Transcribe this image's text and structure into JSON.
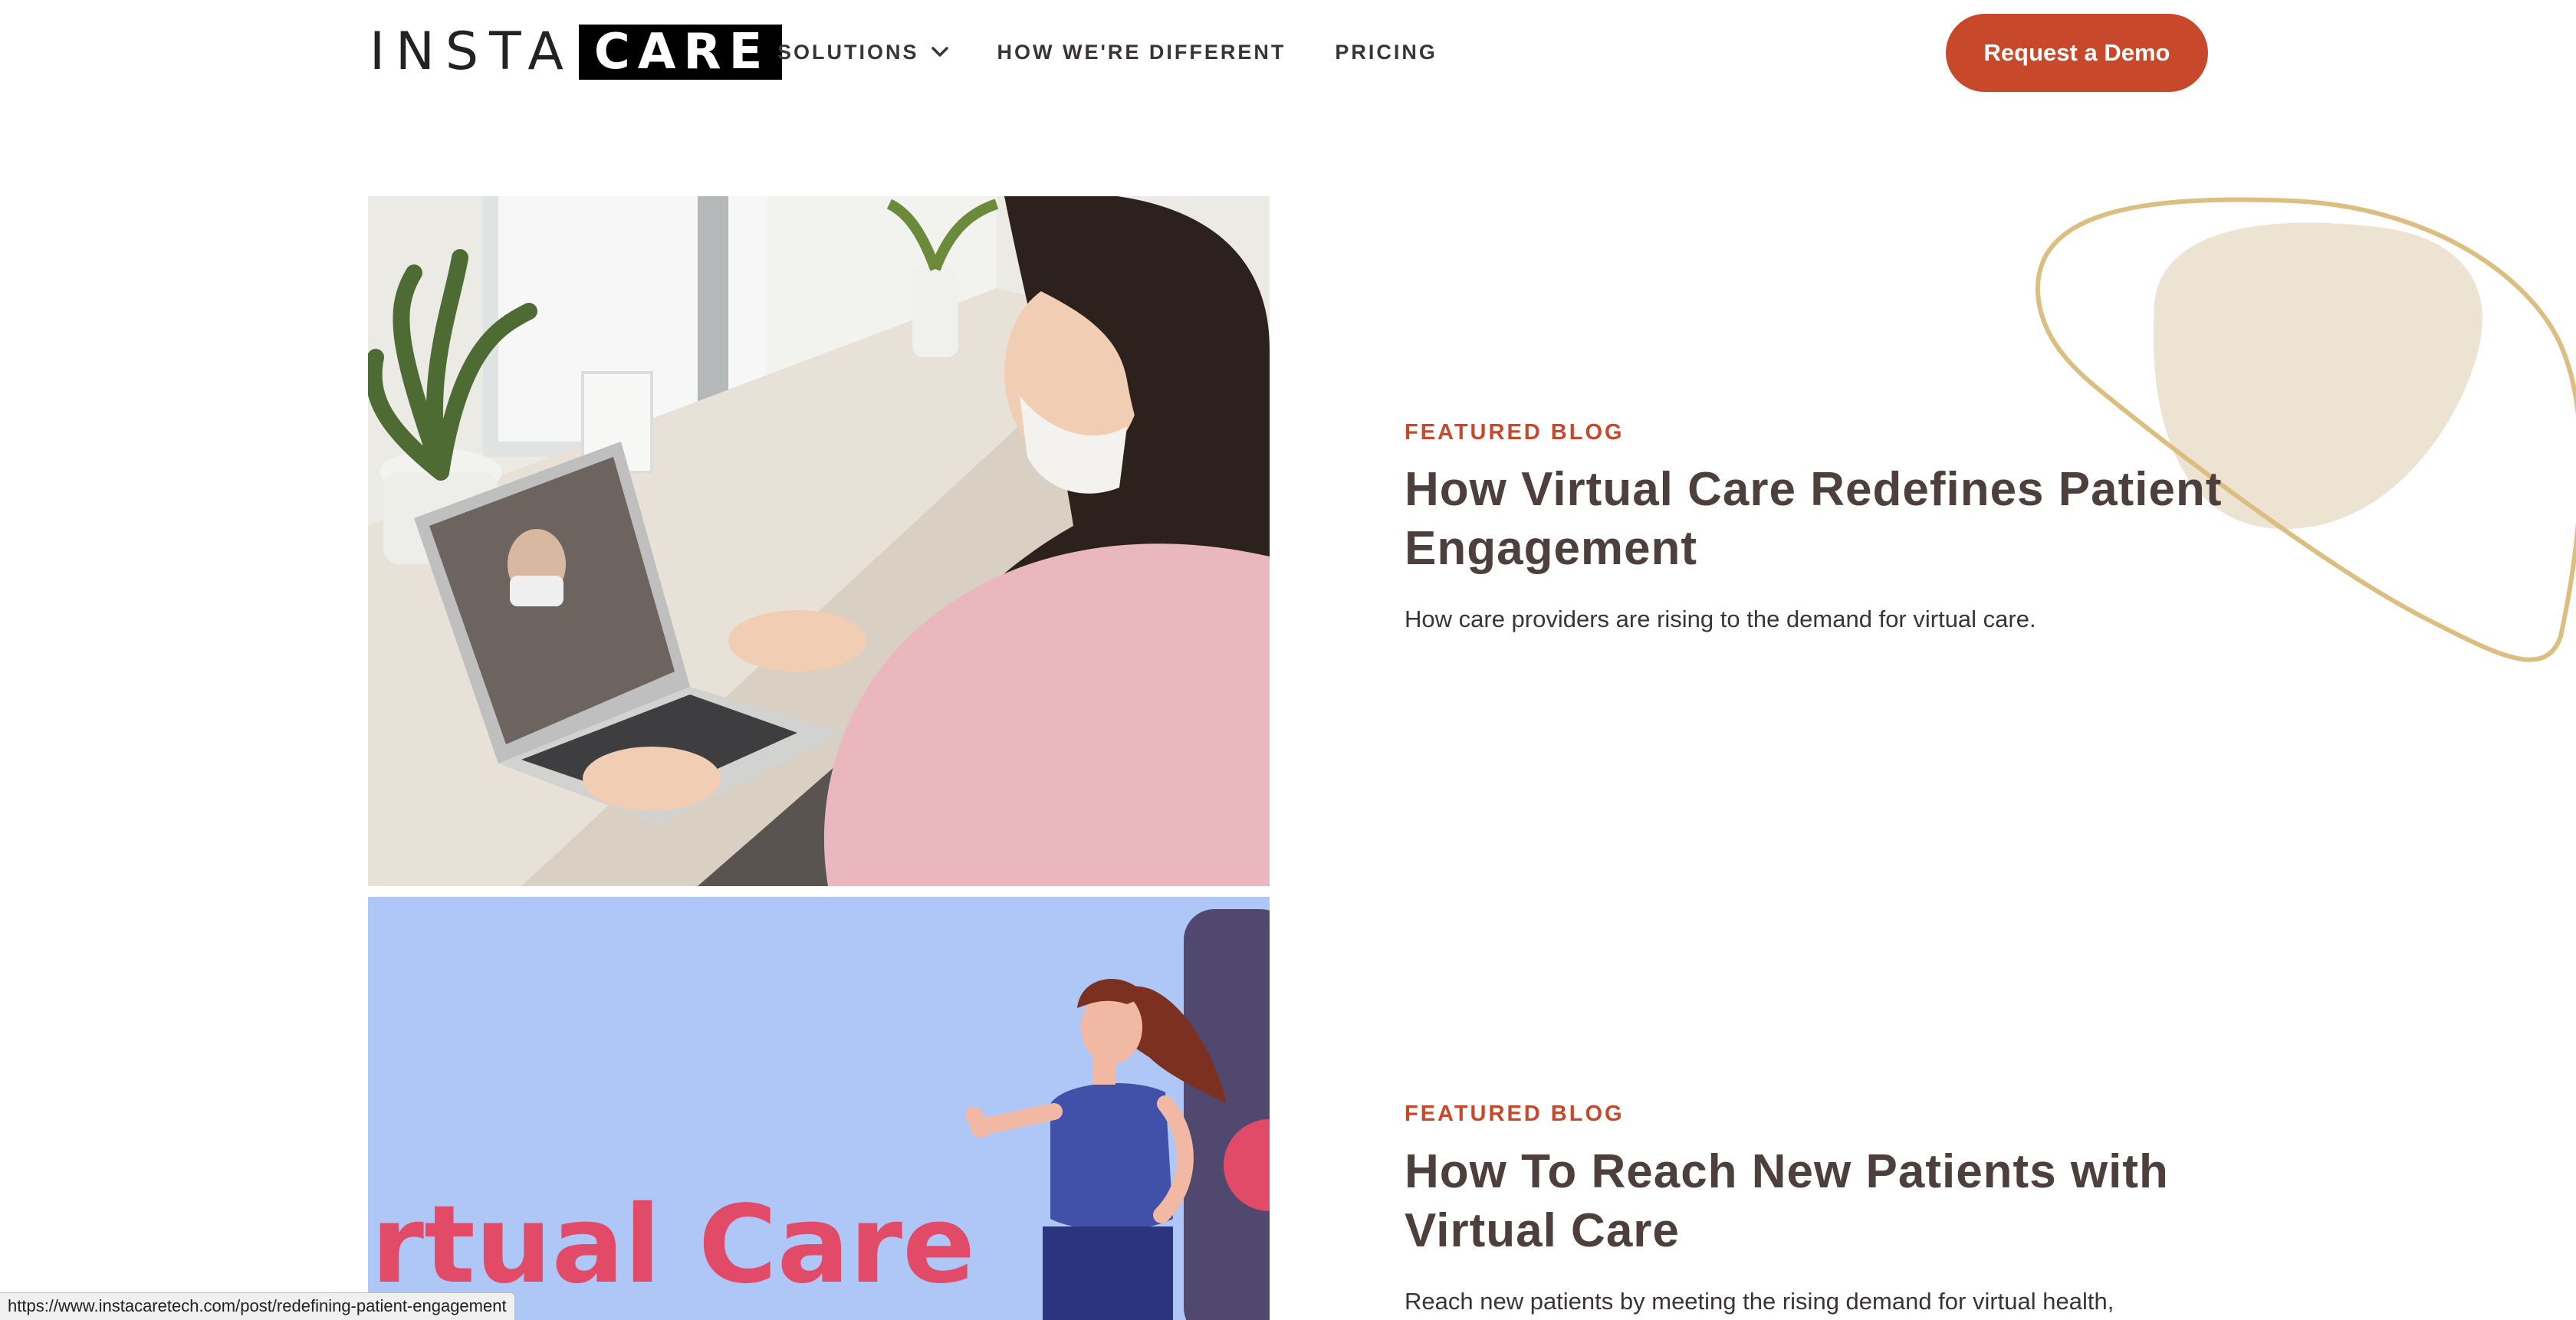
{
  "header": {
    "logo_left": "INSTA",
    "logo_right": "CARE",
    "nav": {
      "solutions": "SOLUTIONS",
      "different": "HOW WE'RE DIFFERENT",
      "pricing": "PRICING"
    },
    "cta": "Request a Demo"
  },
  "posts": [
    {
      "eyebrow": "FEATURED BLOG",
      "title": "How Virtual Care Redefines Patient Engagement",
      "description": "How care providers are rising to the demand for virtual care."
    },
    {
      "eyebrow": "FEATURED BLOG",
      "title": "How To Reach New Patients with Virtual Care",
      "description": "Reach new patients by meeting the rising demand for virtual health,",
      "image_text": "rtual Care"
    }
  ],
  "status_url": "https://www.instacaretech.com/post/redefining-patient-engagement",
  "colors": {
    "accent": "#c7482a",
    "heading": "#4d3f3c",
    "blob_fill": "#ede3d3",
    "blob_stroke": "#dcbf80",
    "card2_bg": "#afc7f7"
  }
}
